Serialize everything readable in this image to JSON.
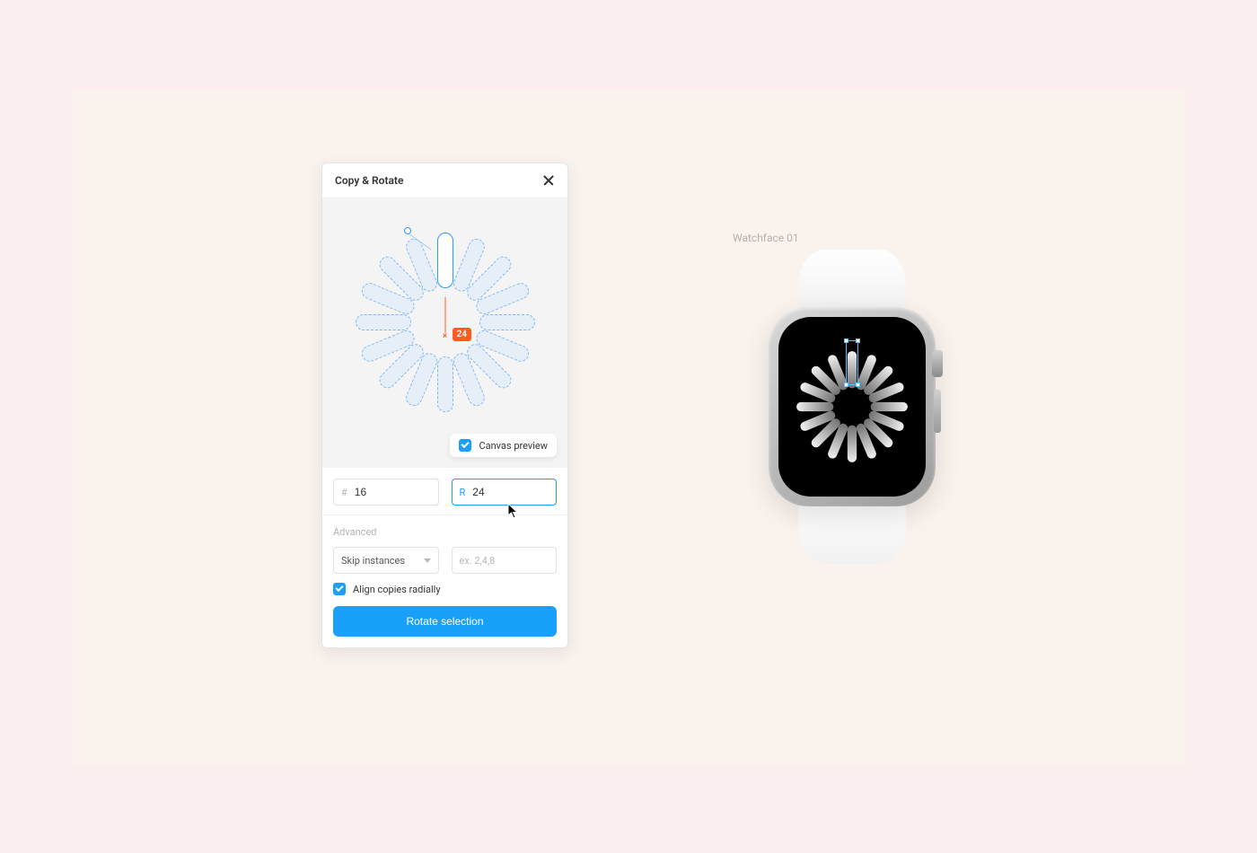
{
  "panel": {
    "title": "Copy & Rotate",
    "badge_value": "24",
    "canvas_preview_label": "Canvas preview",
    "canvas_preview_checked": true,
    "count_prefix": "#",
    "count_value": "16",
    "radius_prefix": "R",
    "radius_value": "24",
    "advanced_label": "Advanced",
    "skip_dropdown_label": "Skip instances",
    "skip_placeholder": "ex. 2,4,8",
    "align_label": "Align copies radially",
    "align_checked": true,
    "primary_button": "Rotate selection",
    "preview_petals": 16
  },
  "watch": {
    "label": "Watchface 01",
    "petals": 16
  }
}
